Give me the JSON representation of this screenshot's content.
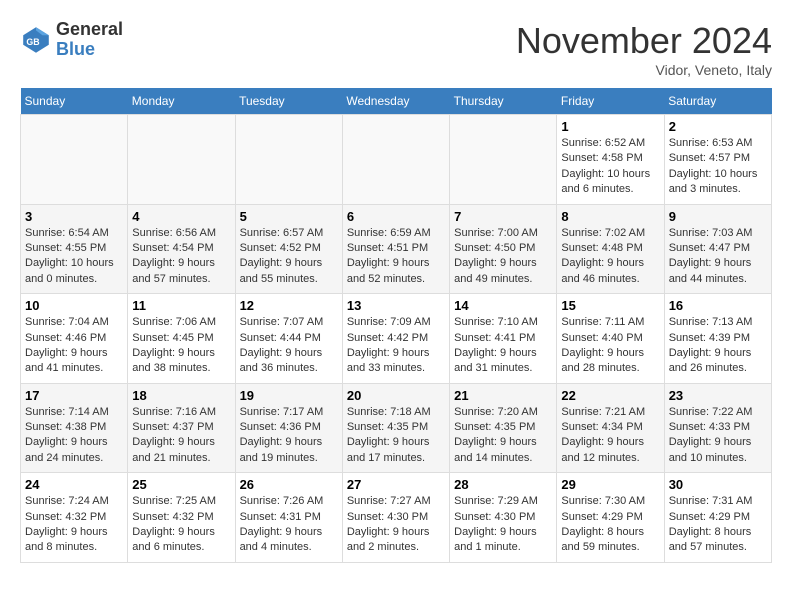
{
  "header": {
    "logo_general": "General",
    "logo_blue": "Blue",
    "month_title": "November 2024",
    "location": "Vidor, Veneto, Italy"
  },
  "weekdays": [
    "Sunday",
    "Monday",
    "Tuesday",
    "Wednesday",
    "Thursday",
    "Friday",
    "Saturday"
  ],
  "weeks": [
    [
      {
        "day": "",
        "info": ""
      },
      {
        "day": "",
        "info": ""
      },
      {
        "day": "",
        "info": ""
      },
      {
        "day": "",
        "info": ""
      },
      {
        "day": "",
        "info": ""
      },
      {
        "day": "1",
        "info": "Sunrise: 6:52 AM\nSunset: 4:58 PM\nDaylight: 10 hours and 6 minutes."
      },
      {
        "day": "2",
        "info": "Sunrise: 6:53 AM\nSunset: 4:57 PM\nDaylight: 10 hours and 3 minutes."
      }
    ],
    [
      {
        "day": "3",
        "info": "Sunrise: 6:54 AM\nSunset: 4:55 PM\nDaylight: 10 hours and 0 minutes."
      },
      {
        "day": "4",
        "info": "Sunrise: 6:56 AM\nSunset: 4:54 PM\nDaylight: 9 hours and 57 minutes."
      },
      {
        "day": "5",
        "info": "Sunrise: 6:57 AM\nSunset: 4:52 PM\nDaylight: 9 hours and 55 minutes."
      },
      {
        "day": "6",
        "info": "Sunrise: 6:59 AM\nSunset: 4:51 PM\nDaylight: 9 hours and 52 minutes."
      },
      {
        "day": "7",
        "info": "Sunrise: 7:00 AM\nSunset: 4:50 PM\nDaylight: 9 hours and 49 minutes."
      },
      {
        "day": "8",
        "info": "Sunrise: 7:02 AM\nSunset: 4:48 PM\nDaylight: 9 hours and 46 minutes."
      },
      {
        "day": "9",
        "info": "Sunrise: 7:03 AM\nSunset: 4:47 PM\nDaylight: 9 hours and 44 minutes."
      }
    ],
    [
      {
        "day": "10",
        "info": "Sunrise: 7:04 AM\nSunset: 4:46 PM\nDaylight: 9 hours and 41 minutes."
      },
      {
        "day": "11",
        "info": "Sunrise: 7:06 AM\nSunset: 4:45 PM\nDaylight: 9 hours and 38 minutes."
      },
      {
        "day": "12",
        "info": "Sunrise: 7:07 AM\nSunset: 4:44 PM\nDaylight: 9 hours and 36 minutes."
      },
      {
        "day": "13",
        "info": "Sunrise: 7:09 AM\nSunset: 4:42 PM\nDaylight: 9 hours and 33 minutes."
      },
      {
        "day": "14",
        "info": "Sunrise: 7:10 AM\nSunset: 4:41 PM\nDaylight: 9 hours and 31 minutes."
      },
      {
        "day": "15",
        "info": "Sunrise: 7:11 AM\nSunset: 4:40 PM\nDaylight: 9 hours and 28 minutes."
      },
      {
        "day": "16",
        "info": "Sunrise: 7:13 AM\nSunset: 4:39 PM\nDaylight: 9 hours and 26 minutes."
      }
    ],
    [
      {
        "day": "17",
        "info": "Sunrise: 7:14 AM\nSunset: 4:38 PM\nDaylight: 9 hours and 24 minutes."
      },
      {
        "day": "18",
        "info": "Sunrise: 7:16 AM\nSunset: 4:37 PM\nDaylight: 9 hours and 21 minutes."
      },
      {
        "day": "19",
        "info": "Sunrise: 7:17 AM\nSunset: 4:36 PM\nDaylight: 9 hours and 19 minutes."
      },
      {
        "day": "20",
        "info": "Sunrise: 7:18 AM\nSunset: 4:35 PM\nDaylight: 9 hours and 17 minutes."
      },
      {
        "day": "21",
        "info": "Sunrise: 7:20 AM\nSunset: 4:35 PM\nDaylight: 9 hours and 14 minutes."
      },
      {
        "day": "22",
        "info": "Sunrise: 7:21 AM\nSunset: 4:34 PM\nDaylight: 9 hours and 12 minutes."
      },
      {
        "day": "23",
        "info": "Sunrise: 7:22 AM\nSunset: 4:33 PM\nDaylight: 9 hours and 10 minutes."
      }
    ],
    [
      {
        "day": "24",
        "info": "Sunrise: 7:24 AM\nSunset: 4:32 PM\nDaylight: 9 hours and 8 minutes."
      },
      {
        "day": "25",
        "info": "Sunrise: 7:25 AM\nSunset: 4:32 PM\nDaylight: 9 hours and 6 minutes."
      },
      {
        "day": "26",
        "info": "Sunrise: 7:26 AM\nSunset: 4:31 PM\nDaylight: 9 hours and 4 minutes."
      },
      {
        "day": "27",
        "info": "Sunrise: 7:27 AM\nSunset: 4:30 PM\nDaylight: 9 hours and 2 minutes."
      },
      {
        "day": "28",
        "info": "Sunrise: 7:29 AM\nSunset: 4:30 PM\nDaylight: 9 hours and 1 minute."
      },
      {
        "day": "29",
        "info": "Sunrise: 7:30 AM\nSunset: 4:29 PM\nDaylight: 8 hours and 59 minutes."
      },
      {
        "day": "30",
        "info": "Sunrise: 7:31 AM\nSunset: 4:29 PM\nDaylight: 8 hours and 57 minutes."
      }
    ]
  ]
}
